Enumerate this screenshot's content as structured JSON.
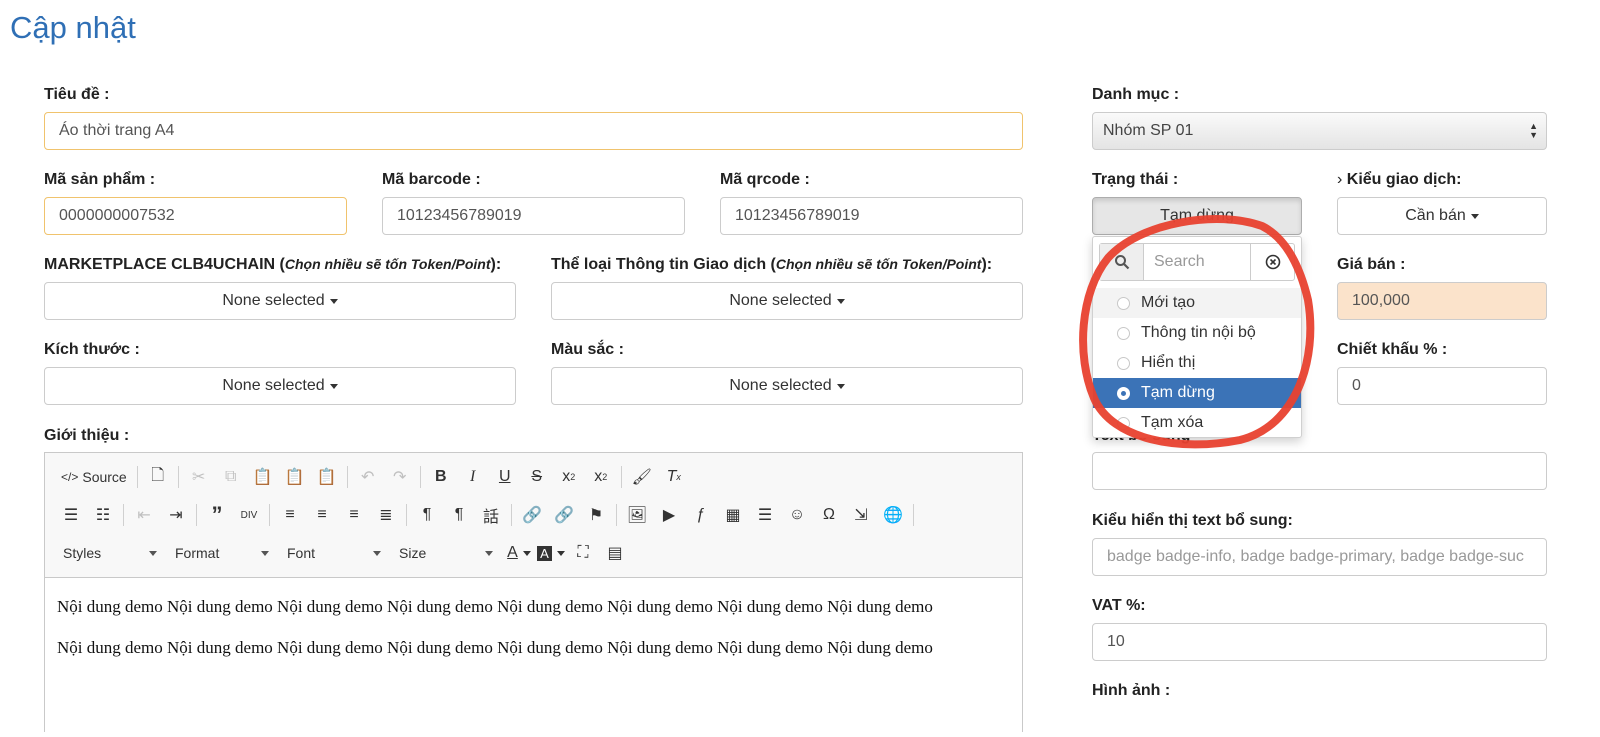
{
  "page_title": "Cập nhật",
  "form": {
    "title_label": "Tiêu đề :",
    "title_value": "Áo thời trang A4",
    "category_label": "Danh mục :",
    "category_value": "Nhóm SP 01",
    "sku_label": "Mã sản phẩm :",
    "sku_value": "0000000007532",
    "barcode_label": "Mã barcode :",
    "barcode_value": "10123456789019",
    "qrcode_label": "Mã qrcode :",
    "qrcode_value": "10123456789019",
    "status_label": "Trạng thái :",
    "status_value": "Tạm dừng",
    "trade_type_label": "Kiểu giao dịch:",
    "trade_type_value": "Cần bán",
    "marketplace_label": "MARKETPLACE CLB4UCHAIN (",
    "marketplace_note": "Chọn nhiều sẽ tốn Token/Point",
    "marketplace_suffix": "):",
    "marketplace_value": "None selected",
    "info_type_label": "Thể loại Thông tin Giao dịch (",
    "info_type_note": "Chọn nhiều sẽ tốn Token/Point",
    "info_type_suffix": "):",
    "info_type_value": "None selected",
    "price_label": "Giá bán :",
    "price_value": "100,000",
    "size_label": "Kích thước :",
    "size_value": "None selected",
    "color_label": "Màu sắc :",
    "color_value": "None selected",
    "discount_label": "Chiết khấu % :",
    "discount_value": "0",
    "intro_label": "Giới thiệu :",
    "extra_text_label": "Text bổ sung",
    "extra_text_value": "",
    "extra_style_label": "Kiểu hiển thị text bổ sung:",
    "extra_style_placeholder": "badge badge-info, badge badge-primary, badge badge-suc",
    "vat_label": "VAT %:",
    "vat_value": "10",
    "image_label": "Hình ảnh :"
  },
  "status_dropdown": {
    "search_placeholder": "Search",
    "options": [
      "Mới tạo",
      "Thông tin nội bộ",
      "Hiển thị",
      "Tạm dừng",
      "Tạm xóa"
    ],
    "selected": "Tạm dừng"
  },
  "editor": {
    "source_label": "Source",
    "styles_label": "Styles",
    "format_label": "Format",
    "font_label": "Font",
    "size_label": "Size",
    "paragraphs": [
      "Nội dung demo  Nội dung demo  Nội dung demo  Nội dung demo  Nội dung demo  Nội dung demo  Nội dung demo  Nội dung demo",
      "Nội dung demo  Nội dung demo  Nội dung demo  Nội dung demo  Nội dung demo  Nội dung demo  Nội dung demo  Nội dung demo"
    ]
  },
  "colors": {
    "title_blue": "#2f6fb5",
    "active_blue": "#3b73b7",
    "annotation_red": "#e8412f",
    "price_bg": "#fbe3cb",
    "warn_border": "#f0c36d"
  }
}
